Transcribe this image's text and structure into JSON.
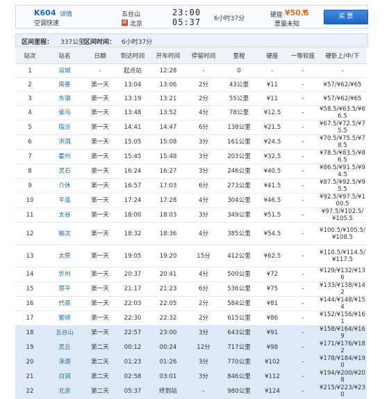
{
  "train": {
    "number": "K604",
    "detail_link": "详情",
    "type": "空调快速",
    "from_station": "五台山",
    "to_station": "北京",
    "end_badge": "终",
    "depart_time": "23:00",
    "arrive_time": "05:37",
    "duration": "6小时37分",
    "seat_label": "硬座",
    "seat_price": "¥50.5",
    "seat_arrow": "▼",
    "ticket_status": "票量未知",
    "buy_label": "买 票"
  },
  "summary": {
    "distance_label": "区间里程：",
    "distance_value": "337公里",
    "time_label": "区间时间：",
    "time_value": "6小时37分"
  },
  "headers": [
    "站次",
    "站名",
    "日期",
    "到达时间",
    "开车时间",
    "停留时间",
    "里程",
    "硬座",
    "一等软座",
    "硬卧上/中/下"
  ],
  "stops": [
    {
      "no": "1",
      "name": "运城",
      "day": "-",
      "arr": "起点站",
      "dep": "12:28",
      "stay": "-",
      "km": "0",
      "seat": "-",
      "soft": "-",
      "sleeper": "-"
    },
    {
      "no": "2",
      "name": "闻喜",
      "day": "第一天",
      "arr": "13:04",
      "dep": "13:06",
      "stay": "2分",
      "km": "43公里",
      "seat": "¥11",
      "soft": "-",
      "sleeper": "¥57/¥62/¥65"
    },
    {
      "no": "3",
      "name": "东镇",
      "day": "第一天",
      "arr": "13:19",
      "dep": "13:21",
      "stay": "2分",
      "km": "55公里",
      "seat": "¥11",
      "soft": "-",
      "sleeper": "¥57/¥62/¥65"
    },
    {
      "no": "4",
      "name": "侯马",
      "day": "第一天",
      "arr": "13:48",
      "dep": "13:52",
      "stay": "4分",
      "km": "78公里",
      "seat": "¥12.5",
      "soft": "-",
      "sleeper": "¥58.5/¥63.5/¥66.5"
    },
    {
      "no": "5",
      "name": "临汾",
      "day": "第一天",
      "arr": "14:41",
      "dep": "14:47",
      "stay": "6分",
      "km": "138公里",
      "seat": "¥21.5",
      "soft": "-",
      "sleeper": "¥67.5/¥72.5/¥75.5"
    },
    {
      "no": "6",
      "name": "洪洞",
      "day": "第一天",
      "arr": "15:05",
      "dep": "15:08",
      "stay": "3分",
      "km": "161公里",
      "seat": "¥24.5",
      "soft": "-",
      "sleeper": "¥70.5/¥75.5/¥78.5"
    },
    {
      "no": "7",
      "name": "霍州",
      "day": "第一天",
      "arr": "15:45",
      "dep": "15:48",
      "stay": "3分",
      "km": "203公里",
      "seat": "¥32.5",
      "soft": "-",
      "sleeper": "¥78.5/¥83.5/¥86.5"
    },
    {
      "no": "8",
      "name": "灵石",
      "day": "第一天",
      "arr": "16:24",
      "dep": "16:27",
      "stay": "3分",
      "km": "246公里",
      "seat": "¥40.5",
      "soft": "-",
      "sleeper": "¥86.5/¥91.5/¥94.5"
    },
    {
      "no": "9",
      "name": "介休",
      "day": "第一天",
      "arr": "16:57",
      "dep": "17:03",
      "stay": "6分",
      "km": "273公里",
      "seat": "¥41.5",
      "soft": "-",
      "sleeper": "¥87.5/¥92.5/¥95.5"
    },
    {
      "no": "10",
      "name": "平遥",
      "day": "第一天",
      "arr": "17:24",
      "dep": "17:28",
      "stay": "4分",
      "km": "304公里",
      "seat": "¥46.5",
      "soft": "-",
      "sleeper": "¥92.5/¥97.5/¥100.5"
    },
    {
      "no": "11",
      "name": "太谷",
      "day": "第一天",
      "arr": "18:00",
      "dep": "18:03",
      "stay": "3分",
      "km": "349公里",
      "seat": "¥51.5",
      "soft": "-",
      "sleeper": "¥97.5/¥102.5/¥105.5"
    },
    {
      "no": "12",
      "name": "榆次",
      "day": "第一天",
      "arr": "18:32",
      "dep": "18:36",
      "stay": "4分",
      "km": "385公里",
      "seat": "¥54.5",
      "soft": "-",
      "sleeper": "¥100.5/¥105.5/¥108.5",
      "tall": true
    },
    {
      "no": "13",
      "name": "太原",
      "day": "第一天",
      "arr": "19:05",
      "dep": "19:20",
      "stay": "15分",
      "km": "412公里",
      "seat": "¥62.5",
      "soft": "-",
      "sleeper": "¥110.5/¥114.5/¥117.5",
      "tall": true
    },
    {
      "no": "14",
      "name": "忻州",
      "day": "第一天",
      "arr": "20:37",
      "dep": "20:41",
      "stay": "4分",
      "km": "500公里",
      "seat": "¥72",
      "soft": "-",
      "sleeper": "¥129/¥132/¥136"
    },
    {
      "no": "15",
      "name": "原平",
      "day": "第一天",
      "arr": "21:17",
      "dep": "21:23",
      "stay": "6分",
      "km": "536公里",
      "seat": "¥75",
      "soft": "-",
      "sleeper": "¥133/¥138/¥142"
    },
    {
      "no": "16",
      "name": "代县",
      "day": "第一天",
      "arr": "22:03",
      "dep": "22:05",
      "stay": "2分",
      "km": "584公里",
      "seat": "¥81",
      "soft": "-",
      "sleeper": "¥144/¥148/¥154"
    },
    {
      "no": "17",
      "name": "繁峙",
      "day": "第一天",
      "arr": "22:30",
      "dep": "22:32",
      "stay": "2分",
      "km": "615公里",
      "seat": "¥86",
      "soft": "-",
      "sleeper": "¥152/¥156/¥161"
    },
    {
      "no": "18",
      "name": "五台山",
      "day": "第一天",
      "arr": "22:57",
      "dep": "23:00",
      "stay": "3分",
      "km": "643公里",
      "seat": "¥91",
      "soft": "-",
      "sleeper": "¥158/¥164/¥169",
      "hl": true
    },
    {
      "no": "19",
      "name": "灵丘",
      "day": "第二天",
      "arr": "00:12",
      "dep": "00:24",
      "stay": "12分",
      "km": "717公里",
      "seat": "¥98",
      "soft": "-",
      "sleeper": "¥171/¥176/¥182",
      "hl": true
    },
    {
      "no": "20",
      "name": "涞源",
      "day": "第二天",
      "arr": "01:23",
      "dep": "01:26",
      "stay": "3分",
      "km": "770公里",
      "seat": "¥102",
      "soft": "-",
      "sleeper": "¥178/¥184/¥190",
      "hl": true
    },
    {
      "no": "21",
      "name": "白涧",
      "day": "第二天",
      "arr": "02:58",
      "dep": "03:01",
      "stay": "3分",
      "km": "846公里",
      "seat": "¥112",
      "soft": "-",
      "sleeper": "¥194/¥200/¥208",
      "hl": true
    },
    {
      "no": "22",
      "name": "北京",
      "day": "第二天",
      "arr": "05:37",
      "dep": "终到站",
      "stay": "-",
      "km": "980公里",
      "seat": "¥124",
      "soft": "-",
      "sleeper": "¥215/¥223/¥230",
      "hl": true
    }
  ]
}
